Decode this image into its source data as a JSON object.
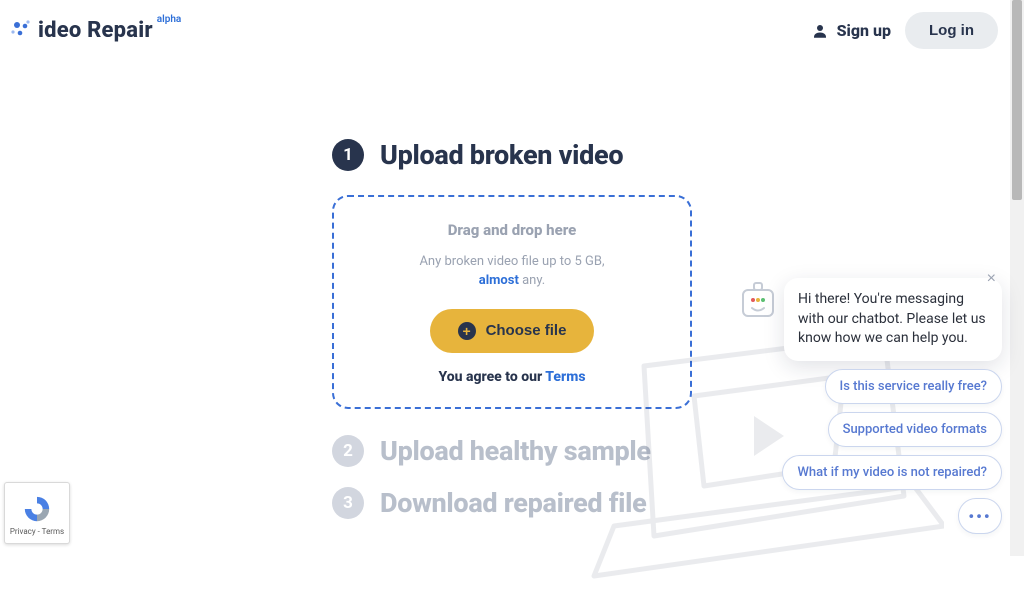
{
  "brand": {
    "name": "ideo Repair",
    "badge": "alpha"
  },
  "header": {
    "signup_label": "Sign up",
    "login_label": "Log in"
  },
  "steps": {
    "s1": {
      "num": "1",
      "title": "Upload broken video"
    },
    "s2": {
      "num": "2",
      "title": "Upload healthy sample"
    },
    "s3": {
      "num": "3",
      "title": "Download repaired file"
    }
  },
  "dropzone": {
    "drag_label": "Drag and drop here",
    "sub_line1": "Any broken video file up to 5 GB,",
    "almost": "almost",
    "sub_line2_tail": " any.",
    "choose_label": "Choose file",
    "agree_prefix": "You agree to our ",
    "terms": "Terms"
  },
  "chat": {
    "greeting": "Hi there! You're messaging with our chatbot. Please let us know how we can help you.",
    "chips": [
      "Is this service really free?",
      "Supported video formats",
      "What if my video is not repaired?"
    ]
  },
  "recaptcha": {
    "footer": "Privacy - Terms"
  }
}
